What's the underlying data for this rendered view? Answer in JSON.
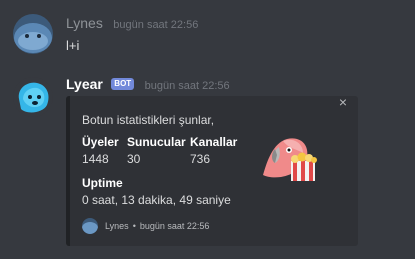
{
  "messages": [
    {
      "username": "Lynes",
      "timestamp": "bugün saat 22:56",
      "content": "l+i"
    },
    {
      "username": "Lyear",
      "badge": "BOT",
      "timestamp": "bugün saat 22:56",
      "embed": {
        "description": "Botun istatistikleri şunlar,",
        "fields": [
          {
            "name": "Üyeler",
            "value": "1448"
          },
          {
            "name": "Sunucular",
            "value": "30"
          },
          {
            "name": "Kanallar",
            "value": "736"
          },
          {
            "name": "Uptime",
            "value": "0 saat, 13 dakika, 49 saniye"
          }
        ],
        "footer": {
          "author": "Lynes",
          "separator": "•",
          "timestamp": "bugün saat 22:56"
        },
        "close_icon": "×",
        "thumbnail_icon": "parrot-popcorn-icon"
      }
    }
  ],
  "colors": {
    "background": "#36393f",
    "embed_bg": "#2f3136",
    "bot_badge": "#7289da"
  }
}
